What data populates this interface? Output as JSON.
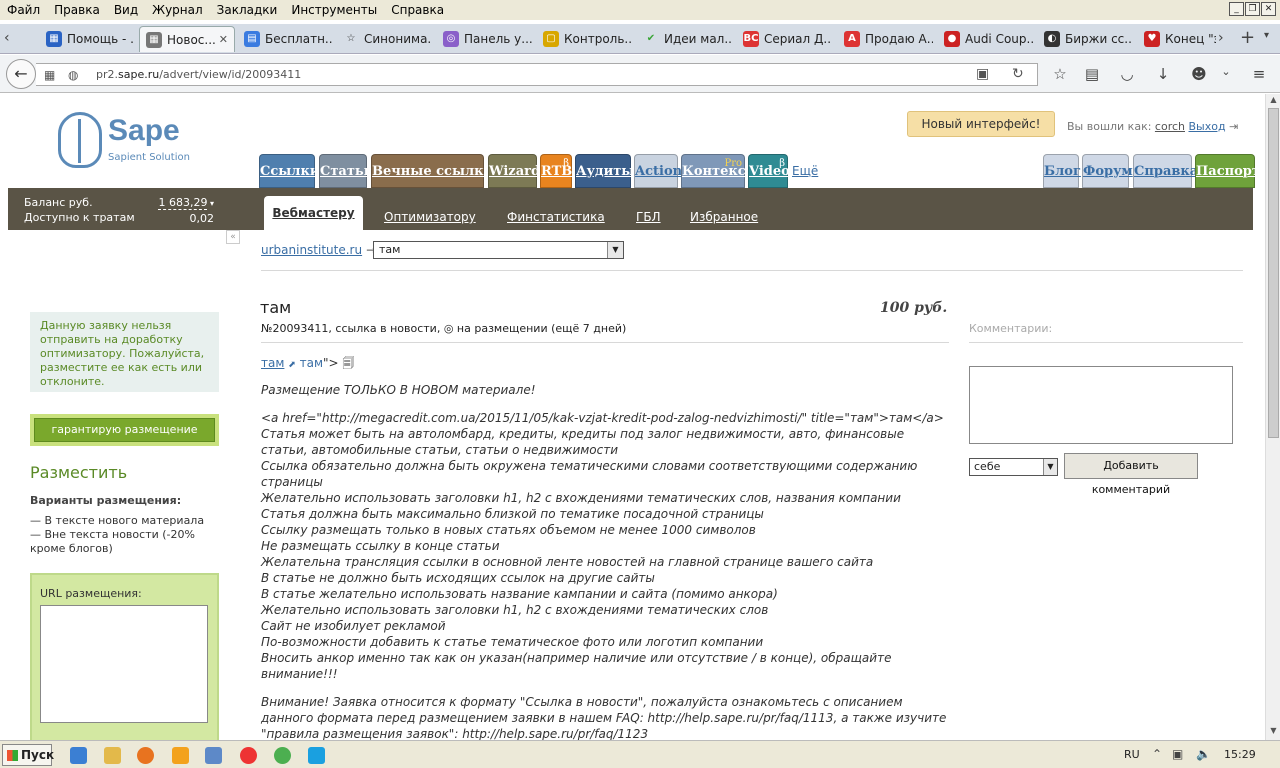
{
  "menubar": {
    "items": [
      "Файл",
      "Правка",
      "Вид",
      "Журнал",
      "Закладки",
      "Инструменты",
      "Справка"
    ]
  },
  "tabs": [
    {
      "label": "Помощь - ...",
      "color": "#2a63c4"
    },
    {
      "label": "Новос...",
      "color": "#777"
    },
    {
      "label": "Бесплатн...",
      "color": "#3a7be0"
    },
    {
      "label": "Синонима...",
      "color": "#333"
    },
    {
      "label": "Панель у...",
      "color": "#8a5fc9"
    },
    {
      "label": "Контроль...",
      "color": "#d8a700"
    },
    {
      "label": "Идеи мал...",
      "color": "#3aa537"
    },
    {
      "label": "Сериал Д...",
      "color": "#d33"
    },
    {
      "label": "Продаю А...",
      "color": "#d33"
    },
    {
      "label": "Audi Coup...",
      "color": "#c22"
    },
    {
      "label": "Биржи сс...",
      "color": "#333"
    },
    {
      "label": "Конец \"эп...",
      "color": "#c22"
    }
  ],
  "tab_badges": {
    "vc": "ВС",
    "a": "А"
  },
  "urlbar": {
    "host_prefix": "pr2.",
    "host": "sape.ru",
    "path": "/advert/view/id/20093411"
  },
  "logo": {
    "name": "Sape",
    "sub": "Sapient Solution"
  },
  "header": {
    "new_ui": "Новый интерфейс!",
    "logged_in_label": "Вы вошли как:",
    "user": "corch",
    "exit": "Выход"
  },
  "main_tabs": [
    {
      "label": "Ссылки",
      "color": "#4f7fae"
    },
    {
      "label": "Статьи",
      "color": "#7f8fa0"
    },
    {
      "label": "Вечные ссылки",
      "color": "#8a6d4c"
    },
    {
      "label": "Wizard",
      "color": "#7d7a55"
    },
    {
      "label": "RTB",
      "color": "#e8841f",
      "sup": "β"
    },
    {
      "label": "Аудиты",
      "color": "#3b5f8c"
    },
    {
      "label": "Action",
      "color": "#c9d3e0",
      "text": "#3a6ea5"
    },
    {
      "label": "Контекст",
      "color": "#7f98b8",
      "sup": "Pro"
    },
    {
      "label": "Video",
      "color": "#2f8b93",
      "sup": "β"
    }
  ],
  "more_label": "Ещё",
  "right_tabs": [
    {
      "label": "Блог",
      "color": "#cfd8e6"
    },
    {
      "label": "Форум",
      "color": "#cfd8e6"
    },
    {
      "label": "Справка",
      "color": "#cfd8e6"
    },
    {
      "label": "Паспорт",
      "color": "#6fa23b",
      "text": "#fff"
    }
  ],
  "balance": {
    "label1": "Баланс  руб.",
    "label2": "Доступно к тратам",
    "value1": "1 683,29",
    "value2": "0,02"
  },
  "sub_tabs": [
    "Вебмастеру",
    "Оптимизатору",
    "Финстатистика",
    "ГБЛ",
    "Избранное"
  ],
  "breadcrumb": {
    "site": "urbaninstitute.ru",
    "arrow": "→",
    "select": "там"
  },
  "advert": {
    "title": "там",
    "price": "100 руб.",
    "meta": "№20093411, ссылка в новости, ◎ на размещении (ещё 7 дней)",
    "anchor1": "там",
    "anchor2": "там",
    "anchor_tail": "\"> 🗐",
    "placement_note": "Размещение ТОЛЬКО В НОВОМ материале!",
    "lines": [
      "<a href=\"http://megacredit.com.ua/2015/11/05/kak-vzjat-kredit-pod-zalog-nedvizhimosti/\" title=\"там\">там</a>",
      "Статья может быть на автоломбард, кредиты, кредиты под залог недвижимости, авто, финансовые статьи, автомобильные статьи, статьи о недвижимости",
      "Ссылка обязательно должна быть окружена тематическими словами соответствующими содержанию страницы",
      "Желательно использовать заголовки h1, h2 с вхождениями тематических слов, названия компании",
      "Статья должна быть максимально близкой по тематике посадочной страницы",
      "Ссылку размещать только в новых статьях объемом не менее 1000 символов",
      "Не размещать ссылку в конце статьи",
      "Желательна трансляция ссылки в основной ленте новостей на главной странице вашего сайта",
      "В статье не должно быть исходящих ссылок на другие сайты",
      "В статье желательно использовать название кампании и сайта (помимо анкора)",
      "Желательно использовать заголовки h1, h2 с вхождениями тематических слов",
      "Сайт не изобилует рекламой",
      "По-возможности добавить к статье тематическое фото или логотип компании",
      "Вносить анкор именно так как он указан(например наличие или отсутствие / в конце), обращайте внимание!!!"
    ],
    "warning": "Внимание! Заявка относится к формату \"Ссылка в новости\", пожалуйста ознакомьтесь с описанием данного формата перед размещением заявки в нашем FAQ: http://help.sape.ru/pr/faq/1113, а также изучите \"правила размещения заявок\": http://help.sape.ru/pr/faq/1123"
  },
  "sidebar": {
    "notice": "Данную заявку нельзя отправить на доработку оптимизатору. Пожалуйста, разместите ее как есть или отклоните.",
    "guarantee": "гарантирую размещение",
    "place_title": "Разместить",
    "variants_title": "Варианты размещения:",
    "variants": [
      "— В тексте нового материала",
      "— Вне текста новости (-20% кроме блогов)"
    ],
    "url_label": "URL размещения:"
  },
  "comments": {
    "label": "Комментарии:",
    "select": "себе",
    "add": "Добавить комментарий"
  },
  "taskbar": {
    "start": "Пуск",
    "lang": "RU",
    "time": "15:29"
  }
}
